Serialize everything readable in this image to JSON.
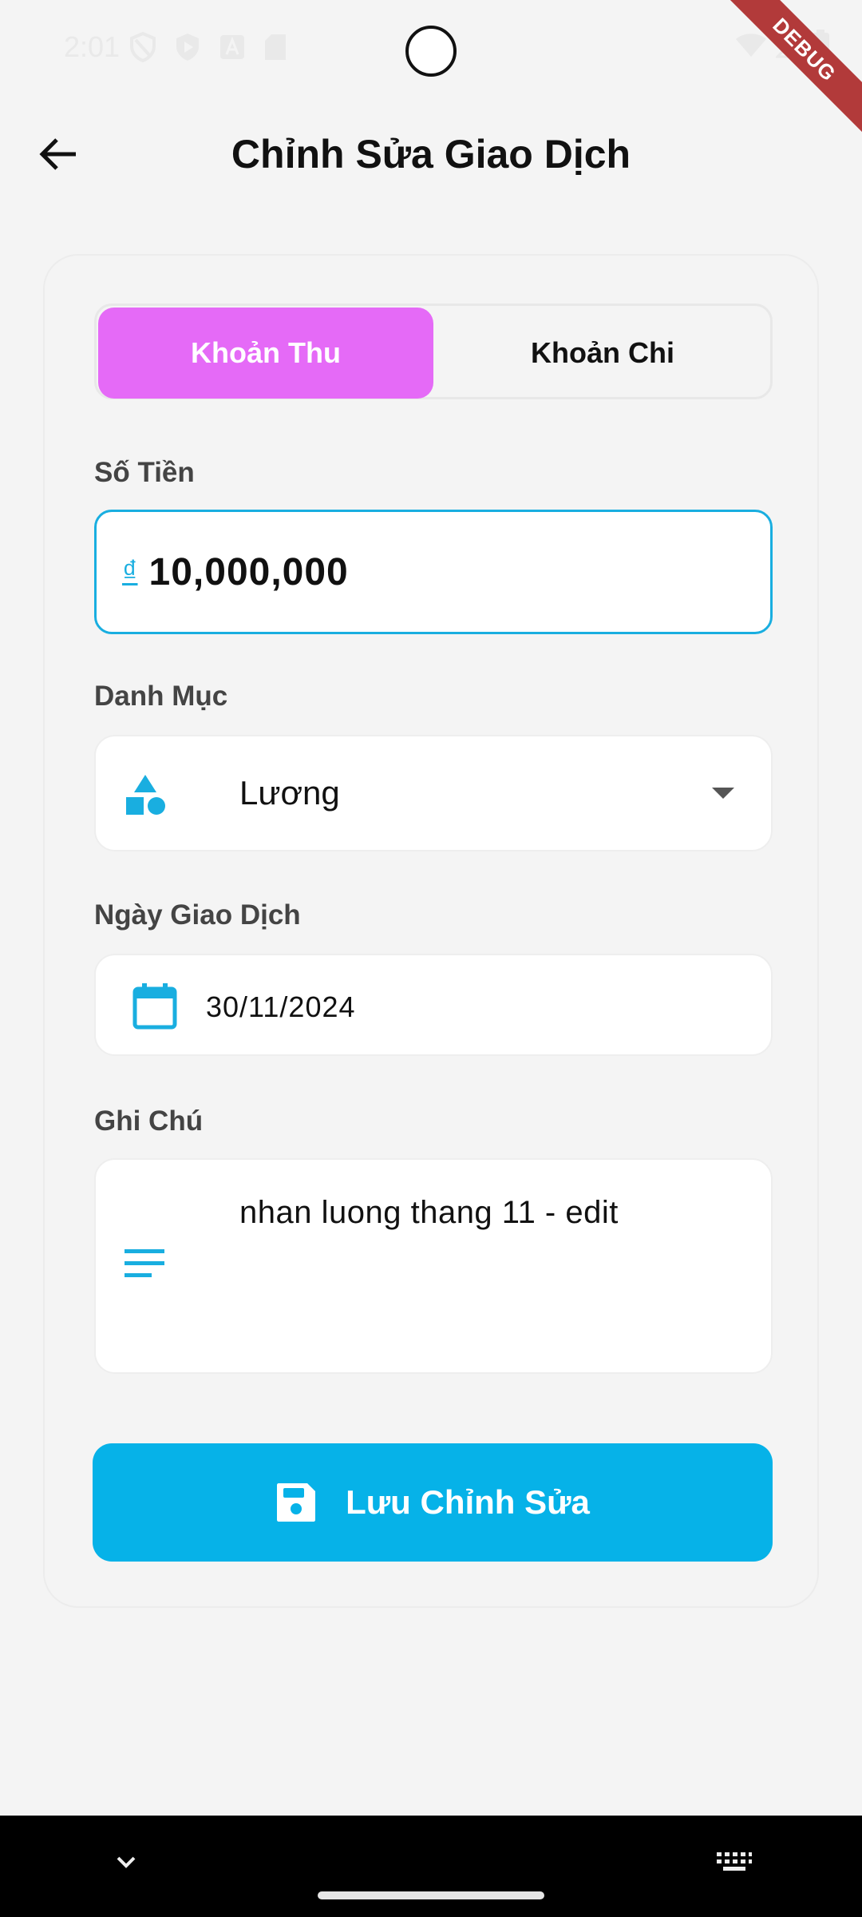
{
  "status_bar": {
    "time": "2:01",
    "debug_label": "DEBUG"
  },
  "header": {
    "title": "Chỉnh Sửa Giao Dịch"
  },
  "type_toggle": {
    "income_label": "Khoản Thu",
    "expense_label": "Khoản Chi",
    "selected": "income"
  },
  "amount": {
    "label": "Số Tiền",
    "currency_symbol": "₫",
    "value": "10,000,000"
  },
  "category": {
    "label": "Danh Mục",
    "value": "Lương"
  },
  "date": {
    "label": "Ngày Giao Dịch",
    "value": "30/11/2024"
  },
  "note": {
    "label": "Ghi Chú",
    "value": "nhan luong thang 11 - edit"
  },
  "save_button": {
    "label": "Lưu Chỉnh Sửa"
  },
  "icons": {
    "back": "arrow-left-icon",
    "category": "shapes-icon",
    "dropdown": "caret-down-icon",
    "calendar": "calendar-icon",
    "notes": "notes-lines-icon",
    "save": "floppy-disk-icon"
  },
  "colors": {
    "accent": "#06b2e8",
    "income_selected": "#e56af7",
    "background": "#f4f4f4",
    "debug_ribbon": "#b23a3a"
  }
}
